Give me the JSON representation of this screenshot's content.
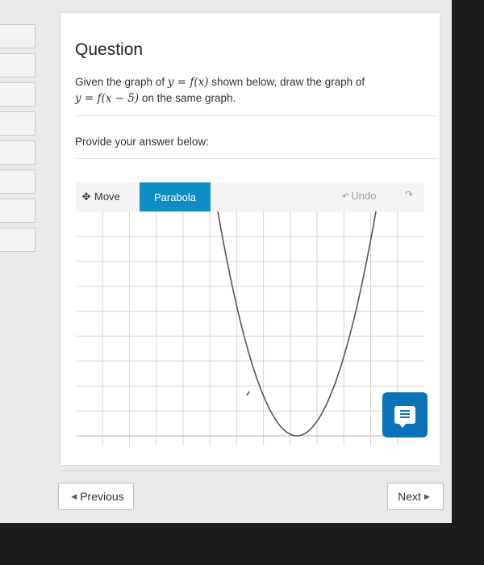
{
  "question": {
    "title": "Question",
    "text_part1": "Given the graph of ",
    "math1": "y = f(x)",
    "text_part2": " shown below, draw the graph of",
    "math2": "y = f(x − 5)",
    "text_part3": " on the same graph.",
    "prompt": "Provide your answer below:"
  },
  "toolbar": {
    "move_label": "Move",
    "parabola_label": "Parabola",
    "undo_label": "Undo"
  },
  "graph": {
    "grid_columns": 13,
    "grid_rows": 9,
    "curve": "parabola opening upward, vertex on bottom gridline",
    "active_tool": "Parabola"
  },
  "navigation": {
    "previous_label": "Previous",
    "next_label": "Next"
  },
  "colors": {
    "accent": "#0f8ec6",
    "feedback": "#0a73b8",
    "curve": "#555555",
    "grid": "#d6d6d6"
  },
  "icons": {
    "move": "move-arrows-icon",
    "undo": "undo-arrow-icon",
    "redo": "redo-arrow-icon",
    "feedback": "chat-bubble-icon"
  }
}
